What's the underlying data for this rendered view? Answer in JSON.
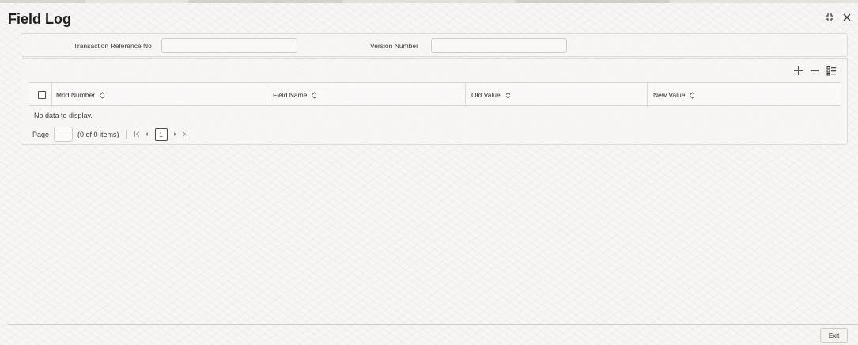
{
  "window": {
    "title": "Field Log"
  },
  "header": {
    "transaction_ref_label": "Transaction Reference No",
    "transaction_ref_value": "",
    "version_label": "Version Number",
    "version_value": ""
  },
  "grid": {
    "columns": [
      "Mod Number",
      "Field Name",
      "Old Value",
      "New Value"
    ],
    "rows": [],
    "empty_message": "No data to display.",
    "pagination": {
      "page_label": "Page",
      "page_value": "",
      "items_text": "(0 of 0 items)",
      "current_page": "1"
    }
  },
  "footer": {
    "exit_label": "Exit"
  },
  "icons": {
    "window": [
      "collapse-icon",
      "close-icon"
    ],
    "grid_tools": [
      "add-row-icon",
      "delete-row-icon",
      "single-record-view-icon"
    ],
    "sort": "sort-icon",
    "pager": [
      "first-page-icon",
      "prev-page-icon",
      "next-page-icon",
      "last-page-icon"
    ]
  }
}
